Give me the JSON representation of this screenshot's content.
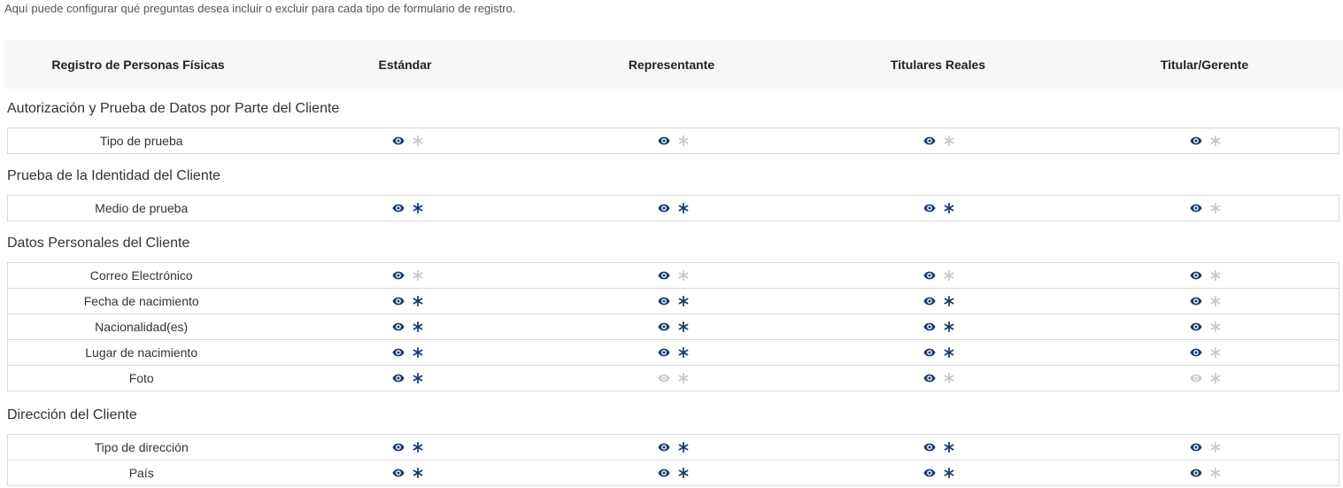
{
  "intro": "Aquí puede configurar qué preguntas desea incluir o excluir para cada tipo de formulario de registro.",
  "header": {
    "title": "Registro de Personas Físicas",
    "columns": [
      "Estándar",
      "Representante",
      "Titulares Reales",
      "Titular/Gerente"
    ]
  },
  "colors": {
    "active": "#1b3a6b",
    "inactive": "#c8c8c8"
  },
  "icons": {
    "visibility": "eye-icon",
    "required": "asterisk-icon"
  },
  "sections": [
    {
      "title": "Autorización y Prueba de Datos por Parte del Cliente",
      "rows": [
        {
          "label": "Tipo de prueba",
          "cells": [
            [
              true,
              false
            ],
            [
              true,
              false
            ],
            [
              true,
              false
            ],
            [
              true,
              false
            ]
          ]
        }
      ]
    },
    {
      "title": "Prueba de la Identidad del Cliente",
      "rows": [
        {
          "label": "Medio de prueba",
          "cells": [
            [
              true,
              true
            ],
            [
              true,
              true
            ],
            [
              true,
              true
            ],
            [
              true,
              false
            ]
          ]
        }
      ]
    },
    {
      "title": "Datos Personales del Cliente",
      "rows": [
        {
          "label": "Correo Electrónico",
          "cells": [
            [
              true,
              false
            ],
            [
              true,
              false
            ],
            [
              true,
              false
            ],
            [
              true,
              false
            ]
          ]
        },
        {
          "label": "Fecha de nacimiento",
          "cells": [
            [
              true,
              true
            ],
            [
              true,
              true
            ],
            [
              true,
              true
            ],
            [
              true,
              false
            ]
          ]
        },
        {
          "label": "Nacionalidad(es)",
          "cells": [
            [
              true,
              true
            ],
            [
              true,
              true
            ],
            [
              true,
              true
            ],
            [
              true,
              false
            ]
          ]
        },
        {
          "label": "Lugar de nacimiento",
          "cells": [
            [
              true,
              true
            ],
            [
              true,
              true
            ],
            [
              true,
              true
            ],
            [
              true,
              false
            ]
          ]
        },
        {
          "label": "Foto",
          "cells": [
            [
              true,
              true
            ],
            [
              false,
              false
            ],
            [
              true,
              false
            ],
            [
              false,
              false
            ]
          ]
        }
      ]
    },
    {
      "title": "Dirección del Cliente",
      "rows": [
        {
          "label": "Tipo de dirección",
          "cells": [
            [
              true,
              true
            ],
            [
              true,
              true
            ],
            [
              true,
              true
            ],
            [
              true,
              false
            ]
          ]
        },
        {
          "label": "País",
          "cells": [
            [
              true,
              true
            ],
            [
              true,
              true
            ],
            [
              true,
              true
            ],
            [
              true,
              false
            ]
          ]
        }
      ]
    }
  ]
}
